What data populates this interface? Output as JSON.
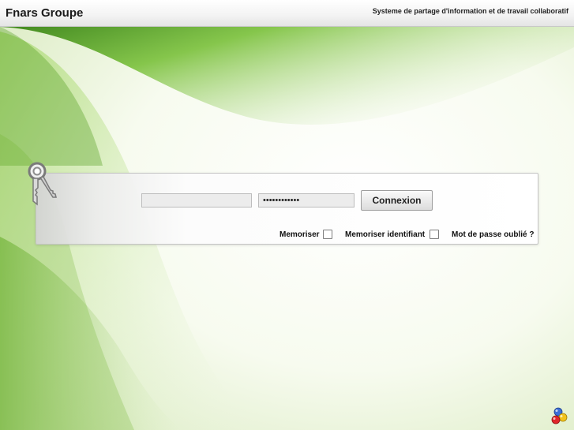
{
  "header": {
    "app_title": "Fnars Groupe",
    "app_subtitle": "Systeme de partage d'information et de travail collaboratif"
  },
  "login": {
    "username_value": "",
    "password_value": "••••••••••••",
    "submit_label": "Connexion",
    "remember_label": "Memoriser",
    "remember_id_label": "Memoriser identifiant",
    "forgot_password_label": "Mot de passe oublié ?"
  },
  "icons": {
    "keys": "keys-icon",
    "logo": "colored-spheres-logo"
  },
  "colors": {
    "accent_green": "#7dc242",
    "header_bg": "#efefef",
    "button_bg": "#e6e6e6"
  }
}
